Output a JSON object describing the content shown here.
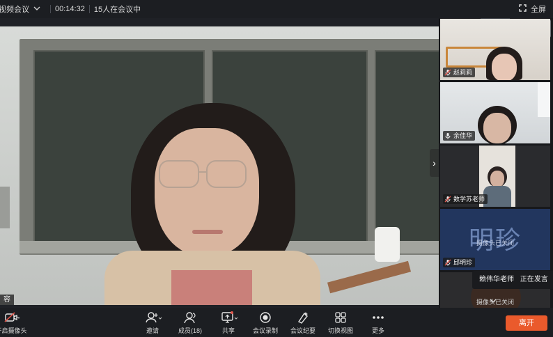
{
  "topbar": {
    "meeting_name": "视频会议",
    "elapsed": "00:14:32",
    "participants_status": "15人在会议中",
    "fullscreen_label": "全屏"
  },
  "main_video": {
    "name_tag": "容"
  },
  "side_tiles": [
    {
      "name": "赵莉莉",
      "muted": true
    },
    {
      "name": "余佳华",
      "muted": false
    },
    {
      "name": "数学苏老师",
      "muted": true
    },
    {
      "name": "邱明珍",
      "muted": true,
      "avatar_text": "明珍",
      "camera_off_text": "摄像头已关闭"
    },
    {
      "camera_off_text": "摄像头已关闭"
    }
  ],
  "speaking_indicator": {
    "speaker": "赖伟华老师",
    "status": "正在发言"
  },
  "toolbar": {
    "camera_label": "开启摄像头",
    "invite_label": "邀请",
    "members_label": "成员(18)",
    "share_label": "共享",
    "record_label": "会议录制",
    "minutes_label": "会议纪要",
    "switch_view_label": "切换视图",
    "more_label": "更多",
    "leave_label": "离开"
  },
  "colors": {
    "leave_button": "#ea5a2c",
    "muted_icon": "#e0554a",
    "toolbar_bg": "#1c1e22",
    "avatar_tile_bg": "#22365e"
  }
}
